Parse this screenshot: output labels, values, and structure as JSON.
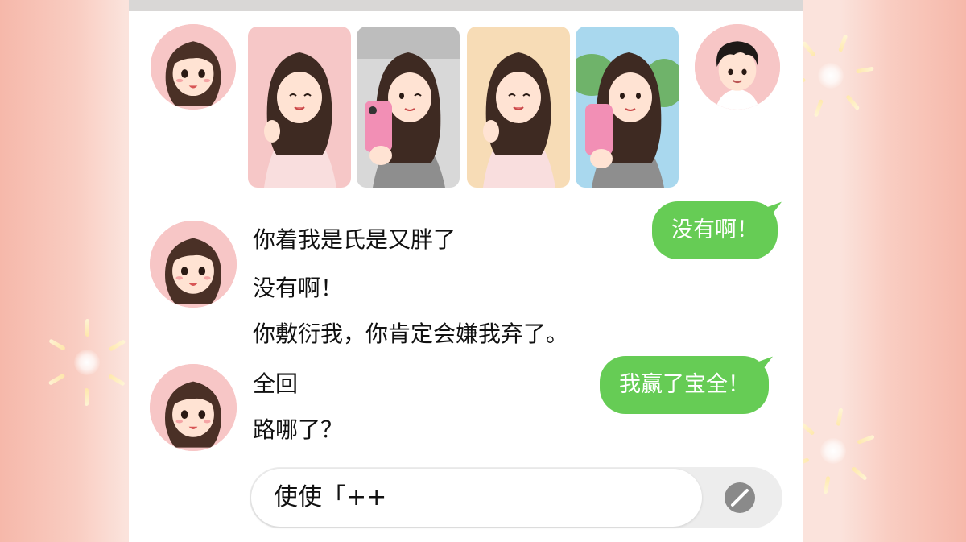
{
  "chat": {
    "messages_left_1": [
      "你着我是氏是又胖了",
      "没有啊！",
      "你敷衍我，你肯定会嫌我弃了。"
    ],
    "messages_left_2": [
      "全回",
      "路哪了？"
    ],
    "bubble_1": "没有啊！",
    "bubble_2": "我赢了宝全！"
  },
  "input": {
    "value": "使使「++"
  },
  "icons": {
    "send": "send-icon",
    "girl_avatar": "girl-avatar",
    "boy_avatar": "boy-avatar"
  },
  "colors": {
    "bubble_green": "#66cc55",
    "background_pink": "#f6b8aa",
    "avatar_pink": "#f7c6c6"
  }
}
